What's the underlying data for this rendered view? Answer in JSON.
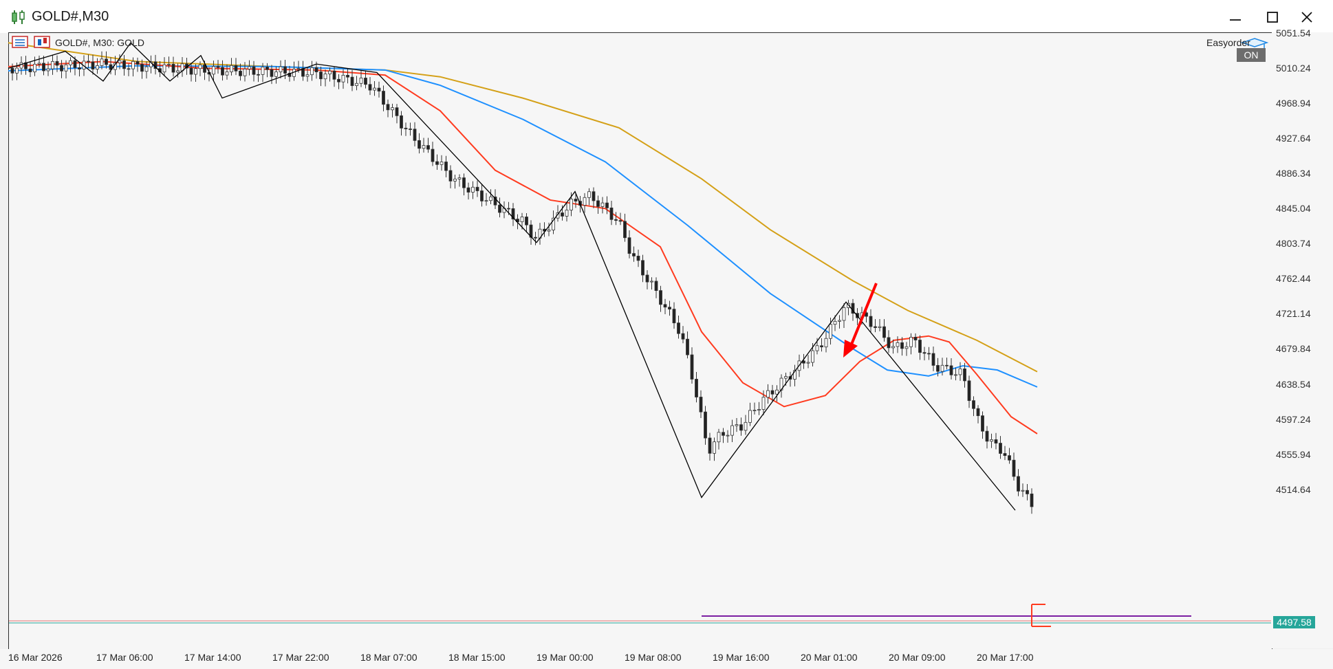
{
  "window": {
    "title": "GOLD#,M30",
    "buttons": [
      "minimize",
      "maximize",
      "close"
    ]
  },
  "chart_header": {
    "symbol_label": "GOLD#, M30:  GOLD",
    "ea_name": "Easyorder",
    "ea_toggle": "ON"
  },
  "price_axis": [
    "5051.54",
    "5010.24",
    "4968.94",
    "4927.64",
    "4886.34",
    "4845.04",
    "4803.74",
    "4762.44",
    "4721.14",
    "4679.84",
    "4638.54",
    "4597.24",
    "4555.94",
    "4514.64"
  ],
  "current_price": "4497.58",
  "time_axis": [
    "16 Mar 2026",
    "17 Mar 06:00",
    "17 Mar 14:00",
    "17 Mar 22:00",
    "18 Mar 07:00",
    "18 Mar 15:00",
    "19 Mar 00:00",
    "19 Mar 08:00",
    "19 Mar 16:00",
    "20 Mar 01:00",
    "20 Mar 09:00",
    "20 Mar 17:00"
  ],
  "colors": {
    "ma_fast": "#ff3b1f",
    "ma_mid": "#1e90ff",
    "ma_slow": "#d4a017",
    "zigzag": "#000000",
    "support_line": "#7b1fa2",
    "bid_line": "#26a69a",
    "arrow": "#ff0000",
    "bear_candle": "#222222",
    "bull_candle": "#ffffff"
  },
  "chart_data": {
    "type": "candlestick",
    "symbol": "GOLD#",
    "timeframe": "M30",
    "y_range": [
      4480,
      5060
    ],
    "zigzag_points": [
      5010,
      4995,
      5040,
      4995,
      5025,
      4975,
      5015,
      5005,
      4805,
      4865,
      4505,
      4735,
      4490
    ],
    "support_level": 4505,
    "annotation": "red arrow pointing to swing high near 4735 at the slow moving average"
  }
}
